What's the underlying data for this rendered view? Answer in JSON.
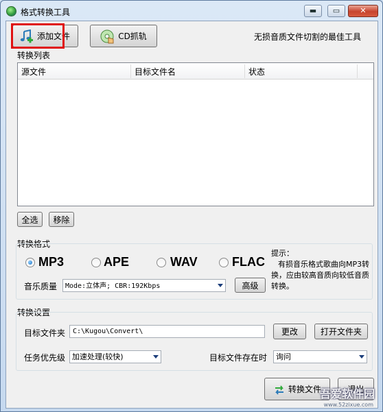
{
  "window": {
    "title": "格式转换工具",
    "min_symbol": "▬",
    "max_symbol": "▭",
    "close_symbol": "✕"
  },
  "toolbar": {
    "add_file_label": "添加文件",
    "cd_rip_label": "CD抓轨",
    "slogan": "无损音质文件切割的最佳工具"
  },
  "list": {
    "section_label": "转换列表",
    "columns": [
      "源文件",
      "目标文件名",
      "状态"
    ],
    "rows": [],
    "select_all_label": "全选",
    "remove_label": "移除"
  },
  "format": {
    "section_label": "转换格式",
    "options": [
      {
        "label": "MP3",
        "checked": true
      },
      {
        "label": "APE",
        "checked": false
      },
      {
        "label": "WAV",
        "checked": false
      },
      {
        "label": "FLAC",
        "checked": false
      }
    ],
    "quality_label": "音乐质量",
    "quality_value": "Mode:立体声; CBR:192Kbps",
    "advanced_label": "高级",
    "hint_title": "提示：",
    "hint_text": "有损音乐格式歌曲向MP3转换，应由较高音质向较低音质转换。"
  },
  "settings": {
    "section_label": "转换设置",
    "target_folder_label": "目标文件夹",
    "target_folder_value": "C:\\Kugou\\Convert\\",
    "change_label": "更改",
    "open_folder_label": "打开文件夹",
    "priority_label": "任务优先级",
    "priority_value": "加速处理(较快)",
    "exists_label": "目标文件存在时",
    "exists_value": "询问"
  },
  "footer": {
    "convert_label": "转换文件",
    "exit_label": "退出"
  },
  "watermark": {
    "main": "吾爱软件园",
    "url": "www.52zixue.com"
  },
  "colors": {
    "highlight_border": "#e01010",
    "radio_fill": "#1a6fc2"
  }
}
